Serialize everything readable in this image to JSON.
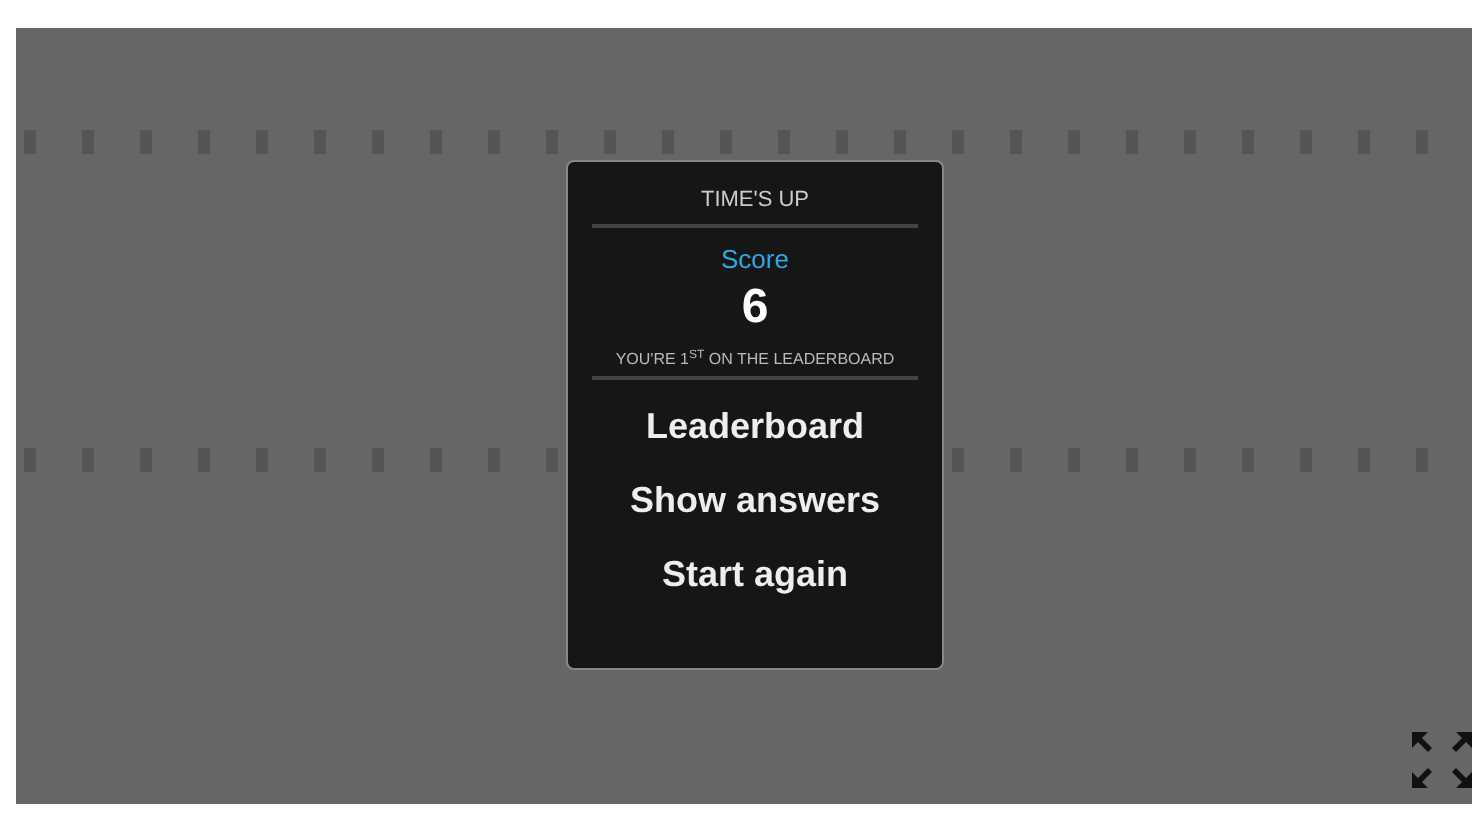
{
  "dialog": {
    "title": "TIME'S UP",
    "score_label": "Score",
    "score": "6",
    "rank_text": "YOU'RE 1$^{ST}$ ON THE LEADERBOARD",
    "actions": [
      {
        "label": "Leaderboard"
      },
      {
        "label": "Show answers"
      },
      {
        "label": "Start again"
      }
    ]
  }
}
